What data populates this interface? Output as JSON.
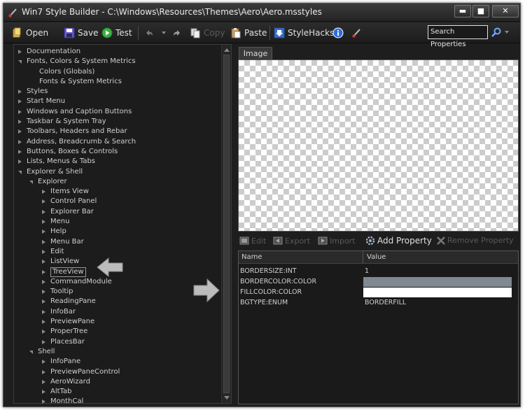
{
  "window": {
    "title": "Win7 Style Builder - C:\\Windows\\Resources\\Themes\\Aero\\Aero.msstyles",
    "min_glyph": "▬",
    "max_glyph": "■",
    "close_glyph": "✕"
  },
  "toolbar": {
    "open": "Open",
    "save": "Save",
    "test": "Test",
    "copy": "Copy",
    "paste": "Paste",
    "stylehacks": "StyleHacks",
    "search_placeholder": "Search Properties"
  },
  "tree": [
    {
      "label": "Documentation",
      "level": 0,
      "state": "collapsed"
    },
    {
      "label": "Fonts, Colors & System Metrics",
      "level": 0,
      "state": "expanded"
    },
    {
      "label": "Colors (Globals)",
      "level": 1,
      "state": "leaf"
    },
    {
      "label": "Fonts & System Metrics",
      "level": 1,
      "state": "leaf"
    },
    {
      "label": "Styles",
      "level": 0,
      "state": "collapsed"
    },
    {
      "label": "Start Menu",
      "level": 0,
      "state": "collapsed"
    },
    {
      "label": "Windows and Caption Buttons",
      "level": 0,
      "state": "collapsed"
    },
    {
      "label": "Taskbar & System Tray",
      "level": 0,
      "state": "collapsed"
    },
    {
      "label": "Toolbars, Headers and Rebar",
      "level": 0,
      "state": "collapsed"
    },
    {
      "label": "Address, Breadcrumb & Search",
      "level": 0,
      "state": "collapsed"
    },
    {
      "label": "Buttons, Boxes & Controls",
      "level": 0,
      "state": "collapsed"
    },
    {
      "label": "Lists, Menus & Tabs",
      "level": 0,
      "state": "collapsed"
    },
    {
      "label": "Explorer & Shell",
      "level": 0,
      "state": "expanded"
    },
    {
      "label": "Explorer",
      "level": 1,
      "state": "expanded"
    },
    {
      "label": "Items View",
      "level": 2,
      "state": "collapsed"
    },
    {
      "label": "Control Panel",
      "level": 2,
      "state": "collapsed"
    },
    {
      "label": "Explorer Bar",
      "level": 2,
      "state": "collapsed"
    },
    {
      "label": "Menu",
      "level": 2,
      "state": "collapsed"
    },
    {
      "label": "Help",
      "level": 2,
      "state": "collapsed"
    },
    {
      "label": "Menu Bar",
      "level": 2,
      "state": "collapsed"
    },
    {
      "label": "Edit",
      "level": 2,
      "state": "collapsed"
    },
    {
      "label": "ListView",
      "level": 2,
      "state": "collapsed"
    },
    {
      "label": "TreeView",
      "level": 2,
      "state": "collapsed",
      "selected": true
    },
    {
      "label": "CommandModule",
      "level": 2,
      "state": "collapsed"
    },
    {
      "label": "Tooltip",
      "level": 2,
      "state": "collapsed"
    },
    {
      "label": "ReadingPane",
      "level": 2,
      "state": "collapsed"
    },
    {
      "label": "InfoBar",
      "level": 2,
      "state": "collapsed"
    },
    {
      "label": "PreviewPane",
      "level": 2,
      "state": "collapsed"
    },
    {
      "label": "ProperTree",
      "level": 2,
      "state": "collapsed"
    },
    {
      "label": "PlacesBar",
      "level": 2,
      "state": "collapsed"
    },
    {
      "label": "Shell",
      "level": 1,
      "state": "expanded"
    },
    {
      "label": "InfoPane",
      "level": 2,
      "state": "collapsed"
    },
    {
      "label": "PreviewPaneControl",
      "level": 2,
      "state": "collapsed"
    },
    {
      "label": "AeroWizard",
      "level": 2,
      "state": "collapsed"
    },
    {
      "label": "AltTab",
      "level": 2,
      "state": "collapsed"
    },
    {
      "label": "MonthCal",
      "level": 2,
      "state": "collapsed"
    }
  ],
  "image_tab": "Image",
  "prop_toolbar": {
    "edit": "Edit",
    "export": "Export",
    "import": "Import",
    "add_property": "Add Property",
    "remove_property": "Remove Property"
  },
  "grid": {
    "col_name": "Name",
    "col_value": "Value",
    "rows": [
      {
        "name": "BORDERSIZE:INT",
        "value": "1",
        "swatch": null
      },
      {
        "name": "BORDERCOLOR:COLOR",
        "value": "",
        "swatch": "#808891"
      },
      {
        "name": "FILLCOLOR:COLOR",
        "value": "",
        "swatch": "#ffffff"
      },
      {
        "name": "BGTYPE:ENUM",
        "value": "BORDERFILL",
        "swatch": null
      }
    ]
  },
  "colors": {
    "window_bg": "#1e1e1e",
    "text": "#d6d6d6",
    "disabled_text": "#5a5a5a"
  }
}
